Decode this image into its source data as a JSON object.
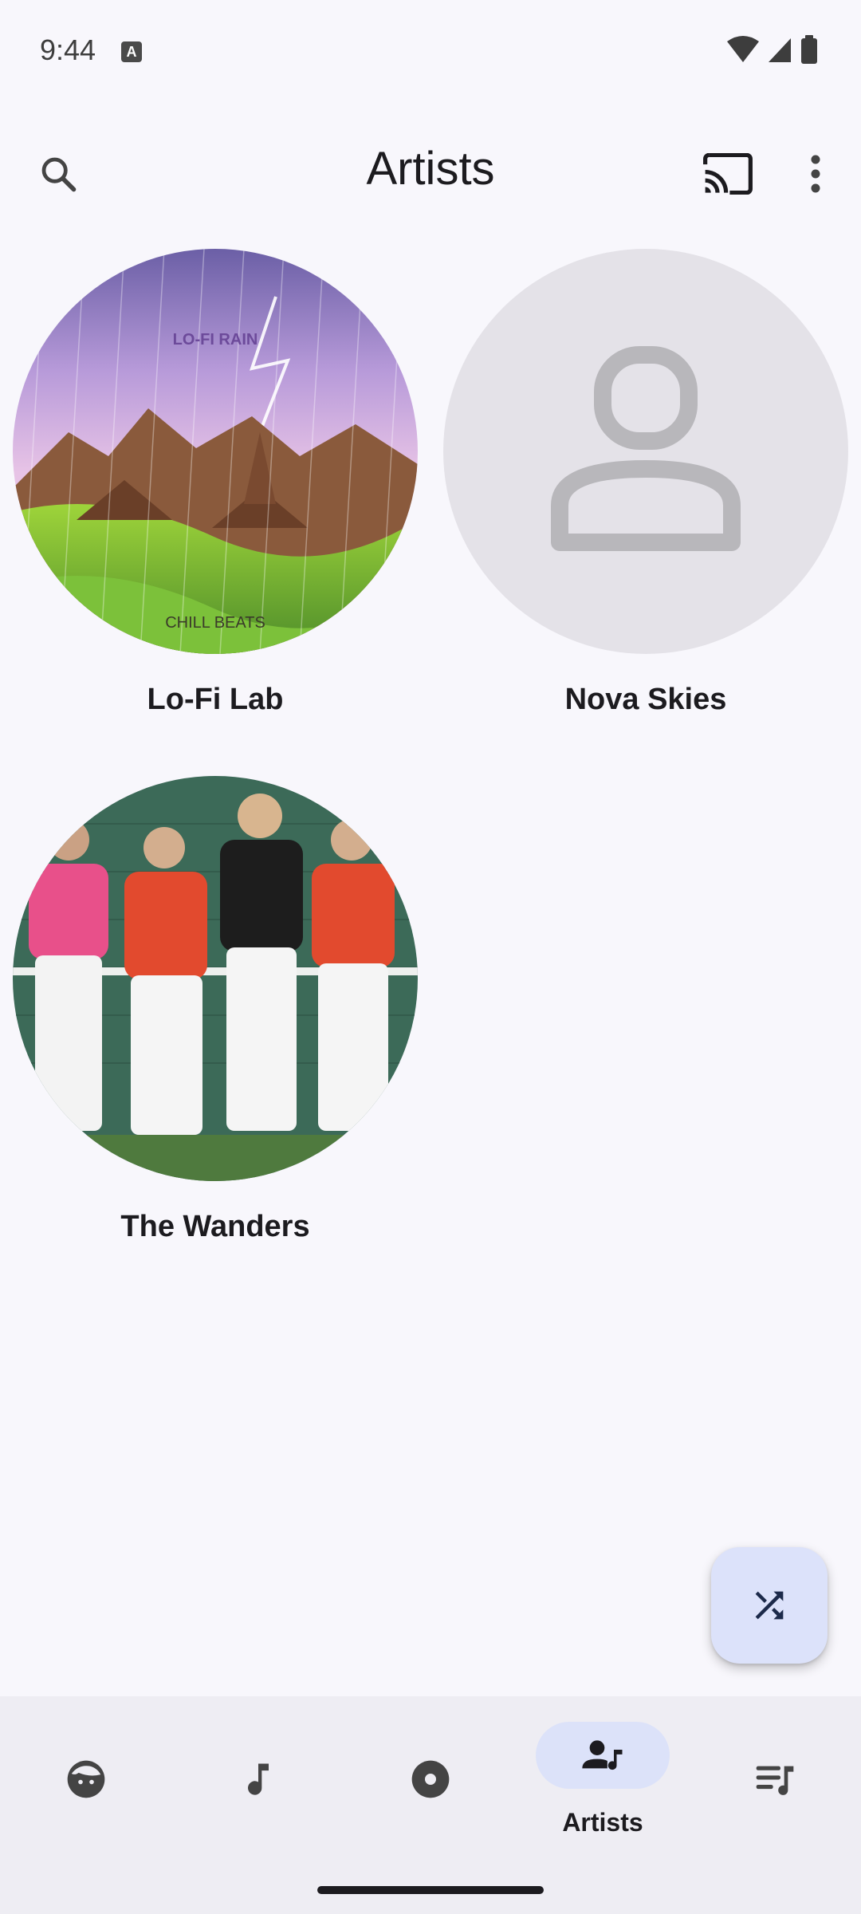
{
  "status_bar": {
    "time": "9:44",
    "notification_glyph": "A"
  },
  "app_bar": {
    "title": "Artists",
    "icons": [
      "search-icon",
      "cast-icon",
      "more-vert-icon"
    ]
  },
  "artists": [
    {
      "name": "Lo-Fi Lab",
      "artwork_text": {
        "top": "LO-FI RAIN",
        "bottom": "CHILL BEATS"
      }
    },
    {
      "name": "Nova Skies"
    },
    {
      "name": "The Wanders"
    }
  ],
  "fab": {
    "icon": "shuffle-icon"
  },
  "bottom_nav": {
    "items": [
      {
        "icon": "face-icon"
      },
      {
        "icon": "music-note-icon"
      },
      {
        "icon": "album-icon"
      },
      {
        "icon": "artist-icon",
        "label": "Artists",
        "active": true
      },
      {
        "icon": "playlist-icon"
      }
    ]
  },
  "colors": {
    "background": "#f8f7fc",
    "nav_background": "#eeedf3",
    "active_pill": "#dce2f9",
    "fab": "#dce2fa",
    "text": "#1c1b1f"
  }
}
